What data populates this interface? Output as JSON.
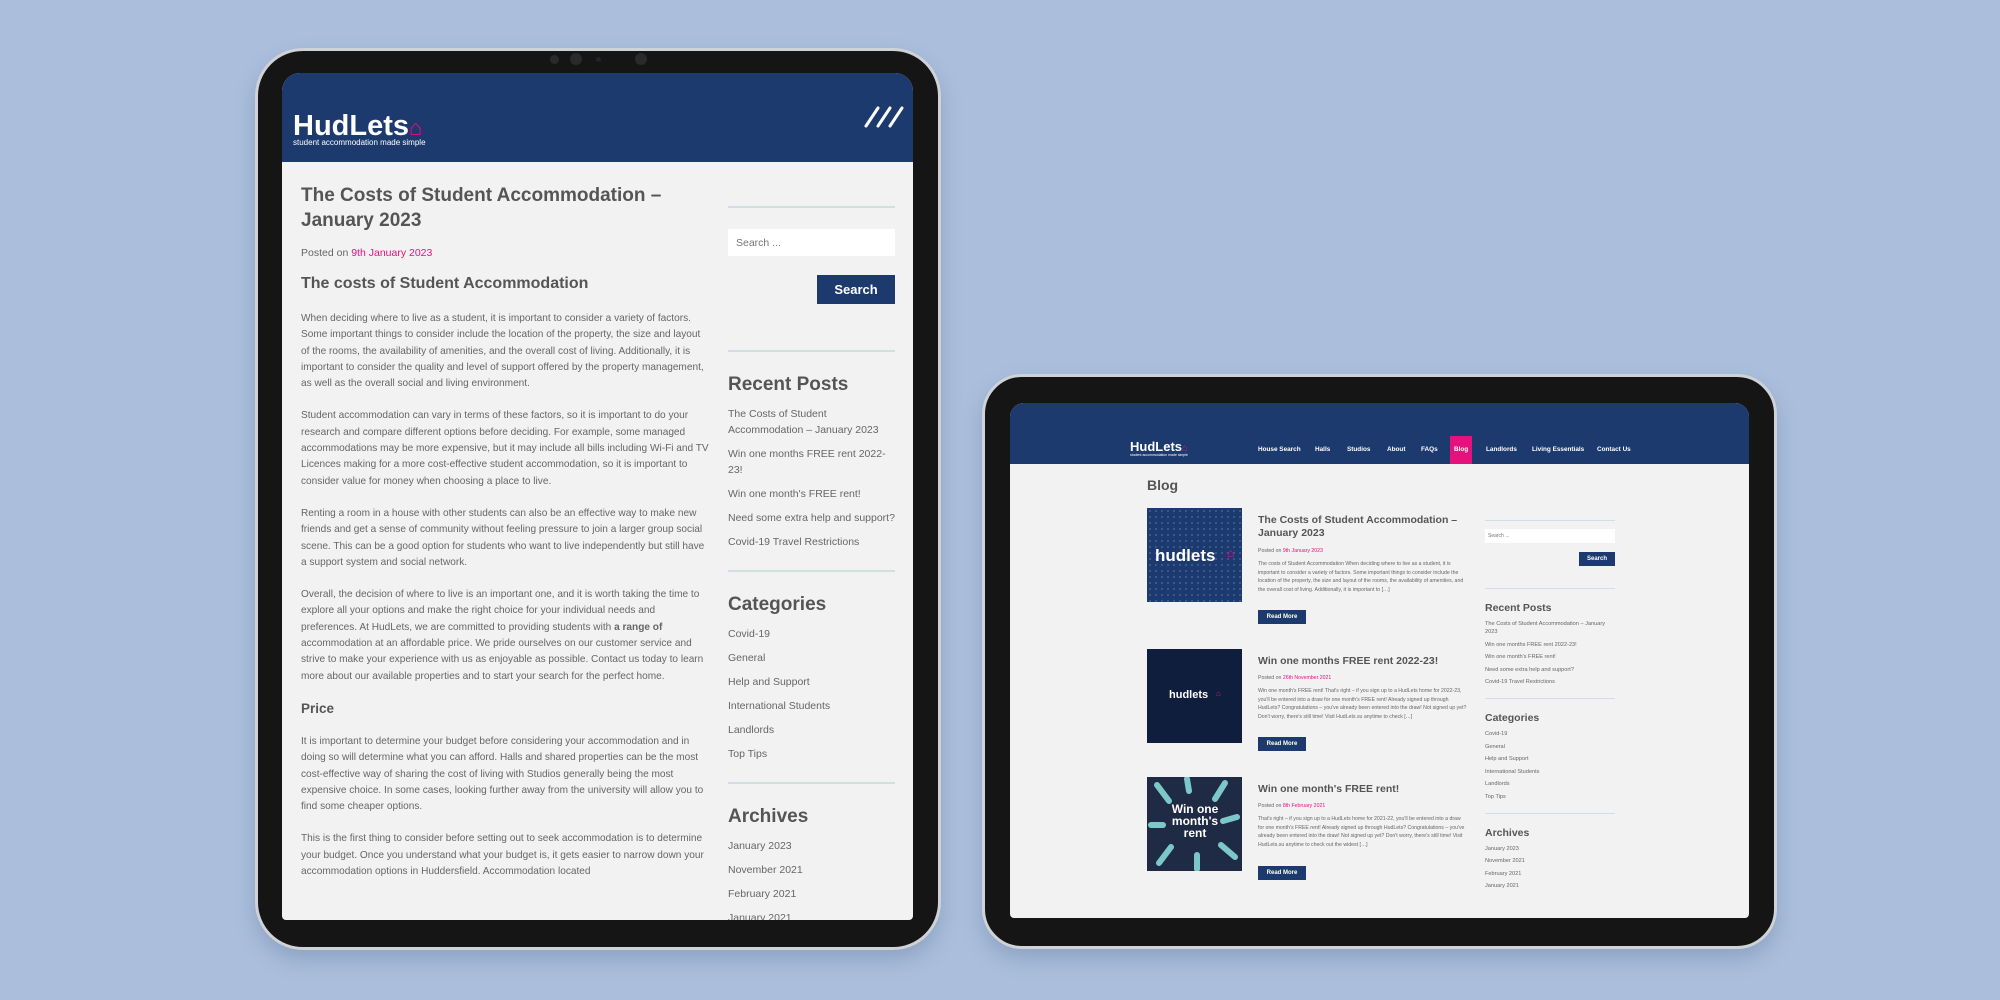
{
  "brand": {
    "name": "HudLets",
    "tagline": "student accommodation made simple",
    "accent": "#e5127d",
    "primary": "#1c3a6e"
  },
  "left_tablet": {
    "menu_icon": "hamburger-slashes-icon",
    "article": {
      "title": "The Costs of Student Accommodation – January 2023",
      "posted_prefix": "Posted on",
      "posted_date": "9th January 2023",
      "heading": "The costs of Student Accommodation",
      "paragraphs": [
        "When deciding where to live as a student, it is important to consider a variety of factors. Some important things to consider include the location of the property, the size and layout of the rooms, the availability of amenities, and the overall cost of living. Additionally, it is important to consider the quality and level of support offered by the property management, as well as the overall social and living environment.",
        "Student accommodation can vary in terms of these factors, so it is important to do your research and compare different options before deciding. For example, some managed accommodations may be more expensive, but it may include all bills including Wi-Fi and TV Licences making for a more cost-effective student accommodation, so it is important to consider value for money when choosing a place to live.",
        "Renting a room in a house with other students can also be an effective way to make new friends and get a sense of community without feeling pressure to join a larger group social scene. This can be a good option for students who want to live independently but still have a support system and social network."
      ],
      "p4_before": "Overall, the decision of where to live is an important one, and it is worth taking the time to explore all your options and make the right choice for your individual needs and preferences. At HudLets, we are committed to providing students with ",
      "p4_bold": "a range of",
      "p4_after": " accommodation at an affordable price. We pride ourselves on our customer service and strive to make your experience with us as enjoyable as possible. Contact us today to learn more about our available properties and to start your search for the perfect home.",
      "subheading": "Price",
      "paragraphs2": [
        "It is important to determine your budget before considering your accommodation and in doing so will determine what you can afford. Halls and shared properties can be the most cost-effective way of sharing the cost of living with Studios generally being the most expensive choice. In some cases, looking further away from the university will allow you to find some cheaper options.",
        "This is the first thing to consider before setting out to seek accommodation is to determine your budget. Once you understand what your budget is, it gets easier to narrow down your accommodation options in Huddersfield. Accommodation located"
      ]
    }
  },
  "sidebar": {
    "search_placeholder": "Search ...",
    "search_button": "Search",
    "recent_title": "Recent Posts",
    "recent": [
      "The Costs of Student Accommodation – January 2023",
      "Win one months FREE rent 2022-23!",
      "Win one month's FREE rent!",
      "Need some extra help and support?",
      "Covid-19 Travel Restrictions"
    ],
    "categories_title": "Categories",
    "categories": [
      "Covid-19",
      "General",
      "Help and Support",
      "International Students",
      "Landlords",
      "Top Tips"
    ],
    "archives_title": "Archives",
    "archives": [
      "January 2023",
      "November 2021",
      "February 2021",
      "January 2021"
    ]
  },
  "right_tablet": {
    "nav": [
      "House Search",
      "Halls",
      "Studios",
      "About",
      "FAQs",
      "Blog",
      "Landlords",
      "Living Essentials",
      "Contact Us"
    ],
    "nav_active": "Blog",
    "page_title": "Blog",
    "read_more": "Read More",
    "posts": [
      {
        "title": "The Costs of Student Accommodation – January 2023",
        "posted_prefix": "Posted on",
        "date": "9th January 2023",
        "excerpt": "The costs of Student Accommodation When deciding where to live as a student, it is important to consider a variety of factors. Some important things to consider include the location of the property, the size and layout of the rooms, the availability of amenities, and the overall cost of living. Additionally, it is important to […]",
        "thumb_text": "hudlets"
      },
      {
        "title": "Win one months FREE rent 2022-23!",
        "posted_prefix": "Posted on",
        "date": "26th November 2021",
        "excerpt": "Win one month's FREE rent! That's right – if you sign up to a HudLets home for 2022-23, you'll be entered into a draw for one month's FREE rent! Already signed up through HudLets?  Congratulations – you've already been entered into the draw! Not signed up yet?  Don't worry, there's still time! Visit HudLets.su anytime to check […]",
        "thumb_text": "hudlets"
      },
      {
        "title": "Win one month's FREE rent!",
        "posted_prefix": "Posted on",
        "date": "8th February 2021",
        "excerpt": "That's right – if you sign up to a HudLets home for 2021-22, you'll be entered into a draw for one month's FREE rent! Already signed up through HudLets? Congratulations – you've already been entered into the draw! Not signed up yet?  Don't worry, there's still time!  Visit HudLets.su anytime to check out the widest […]",
        "thumb_text": "Win one month's rent"
      }
    ]
  }
}
